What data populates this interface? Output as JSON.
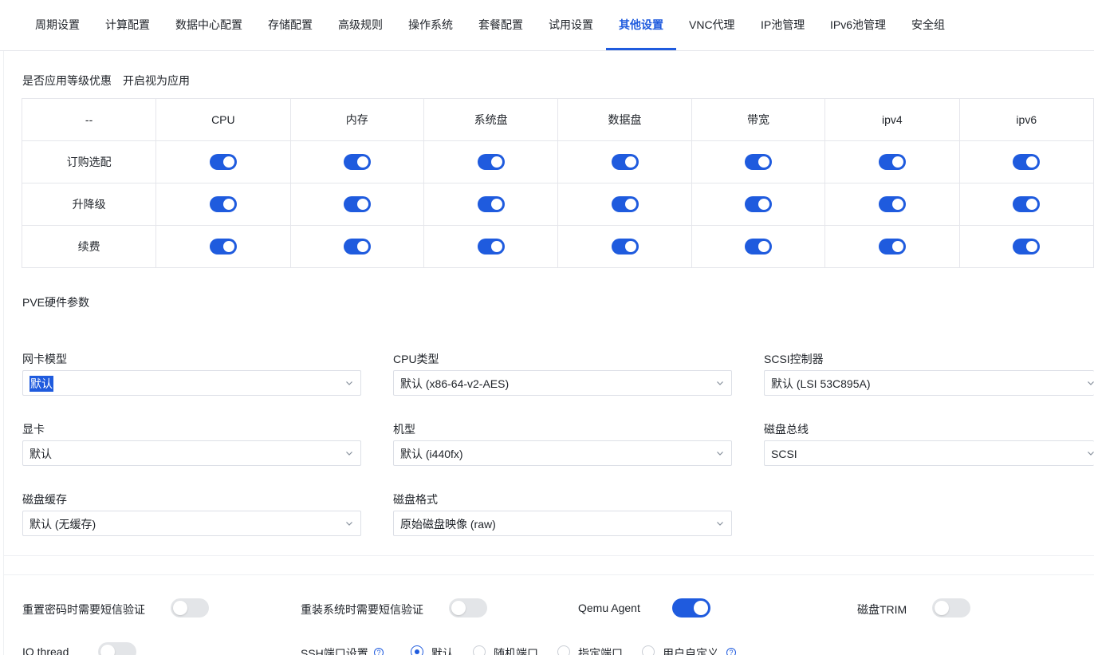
{
  "tabs": [
    {
      "label": "周期设置"
    },
    {
      "label": "计算配置"
    },
    {
      "label": "数据中心配置"
    },
    {
      "label": "存储配置"
    },
    {
      "label": "高级规则"
    },
    {
      "label": "操作系统"
    },
    {
      "label": "套餐配置"
    },
    {
      "label": "试用设置"
    },
    {
      "label": "其他设置"
    },
    {
      "label": "VNC代理"
    },
    {
      "label": "IP池管理"
    },
    {
      "label": "IPv6池管理"
    },
    {
      "label": "安全组"
    }
  ],
  "active_tab": "其他设置",
  "level_discount": {
    "label": "是否应用等级优惠",
    "hint": "开启视为应用",
    "columns": [
      "--",
      "CPU",
      "内存",
      "系统盘",
      "数据盘",
      "带宽",
      "ipv4",
      "ipv6"
    ],
    "rows": [
      {
        "label": "订购选配",
        "values": [
          true,
          true,
          true,
          true,
          true,
          true,
          true
        ]
      },
      {
        "label": "升降级",
        "values": [
          true,
          true,
          true,
          true,
          true,
          true,
          true
        ]
      },
      {
        "label": "续费",
        "values": [
          true,
          true,
          true,
          true,
          true,
          true,
          true
        ]
      }
    ]
  },
  "pve": {
    "title": "PVE硬件参数",
    "fields": {
      "nic_model": {
        "label": "网卡模型",
        "value": "默认"
      },
      "cpu_type": {
        "label": "CPU类型",
        "value": "默认 (x86-64-v2-AES)"
      },
      "scsi_controller": {
        "label": "SCSI控制器",
        "value": "默认 (LSI 53C895A)"
      },
      "gpu": {
        "label": "显卡",
        "value": "默认"
      },
      "machine": {
        "label": "机型",
        "value": "默认 (i440fx)"
      },
      "disk_bus": {
        "label": "磁盘总线",
        "value": "SCSI"
      },
      "disk_cache": {
        "label": "磁盘缓存",
        "value": "默认 (无缓存)"
      },
      "disk_format": {
        "label": "磁盘格式",
        "value": "原始磁盘映像 (raw)"
      }
    }
  },
  "toggles": {
    "reset_password_sms": {
      "label": "重置密码时需要短信验证",
      "on": false
    },
    "reinstall_sms": {
      "label": "重装系统时需要短信验证",
      "on": false
    },
    "qemu_agent": {
      "label": "Qemu Agent",
      "on": true
    },
    "disk_trim": {
      "label": "磁盘TRIM",
      "on": false
    },
    "io_thread": {
      "label": "IO thread",
      "on": false
    }
  },
  "ssh_port": {
    "label": "SSH端口设置",
    "help": "?",
    "options": [
      "默认",
      "随机端口",
      "指定端口",
      "用户自定义"
    ],
    "selected": "默认"
  },
  "colors": {
    "accent": "#1f5bde",
    "border": "#e5e6eb",
    "switch_off": "#e3e5e8"
  },
  "icons": {
    "select_arrow": "chevron-down-icon",
    "help": "question-circle-icon"
  }
}
